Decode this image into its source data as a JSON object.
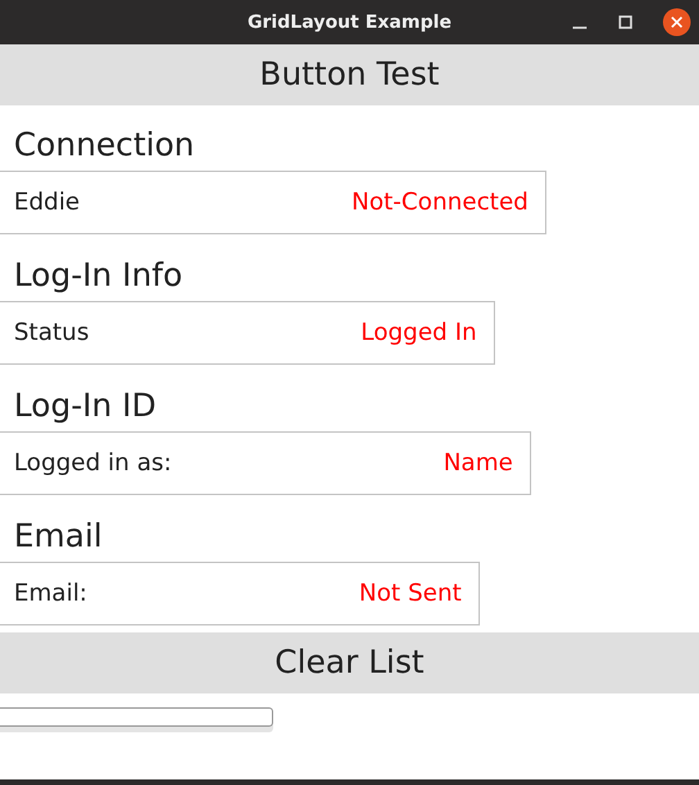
{
  "window": {
    "title": "GridLayout Example"
  },
  "top_button": {
    "label": "Button Test"
  },
  "sections": [
    {
      "heading": "Connection",
      "label": "Eddie",
      "value": "Not-Connected"
    },
    {
      "heading": "Log-In Info",
      "label": "Status",
      "value": "Logged In"
    },
    {
      "heading": "Log-In ID",
      "label": "Logged in as:",
      "value": "Name"
    },
    {
      "heading": "Email",
      "label": "Email:",
      "value": "Not Sent"
    }
  ],
  "bottom_button": {
    "label": "Clear List"
  }
}
